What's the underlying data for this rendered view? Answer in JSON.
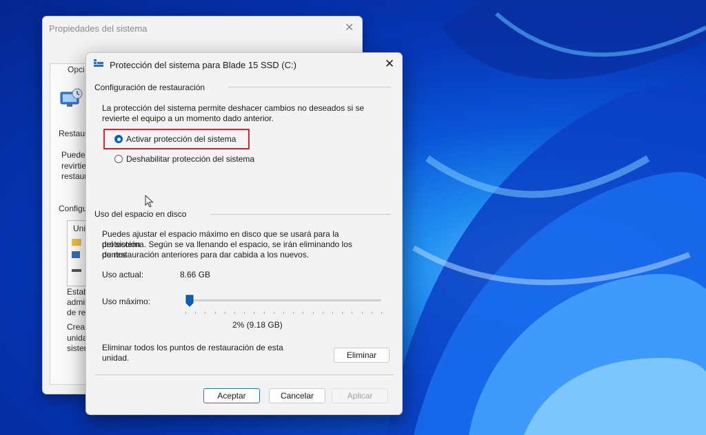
{
  "back_window": {
    "title": "Propiedades del sistema",
    "close_glyph": "✕",
    "tab_label": "Opci",
    "text_restaura": "Restaura",
    "text_puede": "Puede",
    "text_revirtie": "revirtie",
    "text_restaur": "restaur",
    "text_configu": "Configu",
    "text_uni": "Uni",
    "text_estab": "Estab",
    "text_admin": "admin",
    "text_de_re": "de re",
    "text_crea": "Crea",
    "text_unida": "unida",
    "text_sisten": "sisten"
  },
  "dialog": {
    "title": "Protección del sistema para Blade 15 SSD (C:)",
    "close_glyph": "✕",
    "restore_section": {
      "title": "Configuración de restauración",
      "description_line1": "La protección del sistema permite deshacer cambios no deseados si se",
      "description_line2": "revierte el equipo a un momento dado anterior.",
      "options": [
        {
          "label": "Activar protección del sistema",
          "selected": true
        },
        {
          "label": "Deshabilitar protección del sistema",
          "selected": false
        }
      ]
    },
    "disk_section": {
      "title": "Uso del espacio en disco",
      "description_line1": "Puedes ajustar el espacio máximo en disco que se usará para la protección",
      "description_line2": "del sistema. Según se va llenando el espacio, se irán eliminando los puntos",
      "description_line3": "de restauración anteriores para dar cabida a los nuevos.",
      "current_usage_label": "Uso actual:",
      "current_usage_value": "8.66 GB",
      "max_usage_label": "Uso máximo:",
      "max_usage_percent": 2,
      "max_usage_readout": "2% (9.18 GB)",
      "delete_text_line1": "Eliminar todos los puntos de restauración de esta",
      "delete_text_line2": "unidad.",
      "delete_button": "Eliminar"
    },
    "buttons": {
      "ok": "Aceptar",
      "cancel": "Cancelar",
      "apply": "Aplicar"
    }
  },
  "colors": {
    "accent": "#0a5fb8",
    "highlight_box": "#e0202a"
  }
}
